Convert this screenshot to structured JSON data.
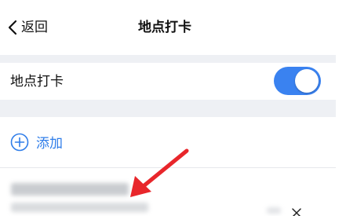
{
  "navbar": {
    "back_label": "返回",
    "title": "地点打卡"
  },
  "toggle_row": {
    "label": "地点打卡",
    "enabled": true
  },
  "add_row": {
    "label": "添加"
  },
  "colors": {
    "accent": "#3a82f0",
    "link": "#2f7de9",
    "band": "#eef0f4",
    "annotation": "#e8262b"
  },
  "icons": {
    "back": "chevron-left-icon",
    "add": "plus-circle-icon",
    "delete": "close-icon"
  }
}
